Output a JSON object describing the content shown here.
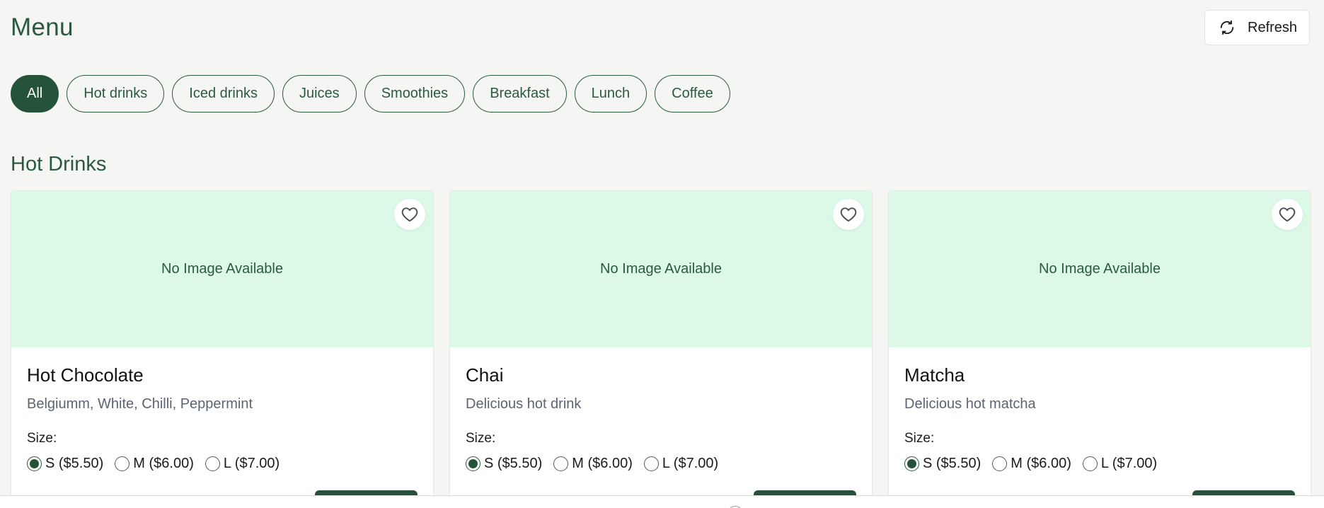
{
  "header": {
    "title": "Menu",
    "refresh_label": "Refresh"
  },
  "filters": [
    {
      "label": "All",
      "active": true
    },
    {
      "label": "Hot drinks",
      "active": false
    },
    {
      "label": "Iced drinks",
      "active": false
    },
    {
      "label": "Juices",
      "active": false
    },
    {
      "label": "Smoothies",
      "active": false
    },
    {
      "label": "Breakfast",
      "active": false
    },
    {
      "label": "Lunch",
      "active": false
    },
    {
      "label": "Coffee",
      "active": false
    }
  ],
  "section": {
    "title": "Hot Drinks"
  },
  "cards": [
    {
      "image_placeholder": "No Image Available",
      "name": "Hot Chocolate",
      "description": "Belgiumm, White, Chilli, Peppermint",
      "size_label": "Size:",
      "sizes": [
        {
          "label": "S ($5.50)",
          "checked": true
        },
        {
          "label": "M ($6.00)",
          "checked": false
        },
        {
          "label": "L ($7.00)",
          "checked": false
        }
      ]
    },
    {
      "image_placeholder": "No Image Available",
      "name": "Chai",
      "description": "Delicious hot drink",
      "size_label": "Size:",
      "sizes": [
        {
          "label": "S ($5.50)",
          "checked": true
        },
        {
          "label": "M ($6.00)",
          "checked": false
        },
        {
          "label": "L ($7.00)",
          "checked": false
        }
      ]
    },
    {
      "image_placeholder": "No Image Available",
      "name": "Matcha",
      "description": "Delicious hot matcha",
      "size_label": "Size:",
      "sizes": [
        {
          "label": "S ($5.50)",
          "checked": true
        },
        {
          "label": "M ($6.00)",
          "checked": false
        },
        {
          "label": "L ($7.00)",
          "checked": false
        }
      ]
    }
  ],
  "icons": {
    "refresh": "refresh-icon",
    "favorite": "heart-icon"
  },
  "colors": {
    "brand_green": "#245339",
    "image_bg": "#dcf9e8",
    "page_bg": "#f5f5f3"
  }
}
